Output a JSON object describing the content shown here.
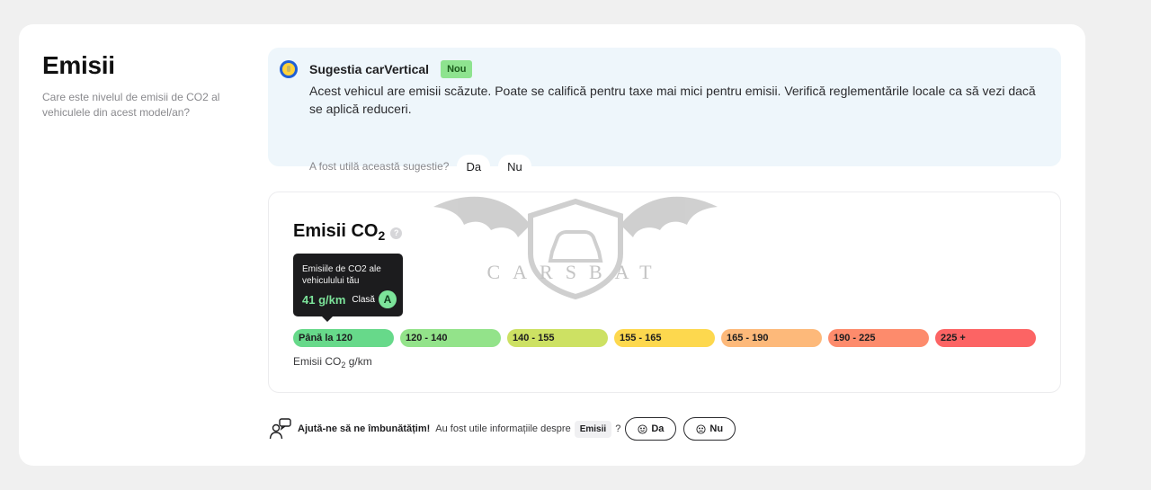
{
  "section": {
    "title": "Emisii",
    "subtitle": "Care este nivelul de emisii de CO2 al vehiculele din acest model/an?"
  },
  "suggestion": {
    "logo_icon": "carvertical-logo-icon",
    "title": "Sugestia carVertical",
    "badge": "Nou",
    "text": "Acest vehicul are emisii scăzute. Poate se califică pentru taxe mai mici pentru emisii. Verifică reglementările locale ca să vezi dacă se aplică reduceri.",
    "ask": "A fost utilă această sugestie?",
    "yes": "Da",
    "no": "Nu"
  },
  "co2": {
    "title": "Emisii CO",
    "title_sub": "2",
    "help_icon": "?",
    "tooltip": {
      "label": "Emisiile de CO2 ale vehiculului tău",
      "value": "41 g/km",
      "class_label": "Clasă",
      "class_value": "A"
    },
    "bands": [
      {
        "label": "Până la 120",
        "color": "#67d98a"
      },
      {
        "label": "120 - 140",
        "color": "#93e38a"
      },
      {
        "label": "140 - 155",
        "color": "#cde163"
      },
      {
        "label": "155 - 165",
        "color": "#fdd84e"
      },
      {
        "label": "165 - 190",
        "color": "#fdb97a"
      },
      {
        "label": "190 - 225",
        "color": "#fd8b6c"
      },
      {
        "label": "225 +",
        "color": "#fc6464"
      }
    ],
    "active_band": 0,
    "unit_prefix": "Emisii CO",
    "unit_sub": "2",
    "unit_suffix": " g/km"
  },
  "feedback": {
    "icon": "feedback-person-chat-icon",
    "bold": "Ajută-ne să ne îmbunătățim!",
    "text": "Au fost utile informațiile despre",
    "chip": "Emisii",
    "question_mark": "?",
    "yes": "Da",
    "no": "Nu"
  },
  "watermark": {
    "text": "CARSBAT"
  }
}
